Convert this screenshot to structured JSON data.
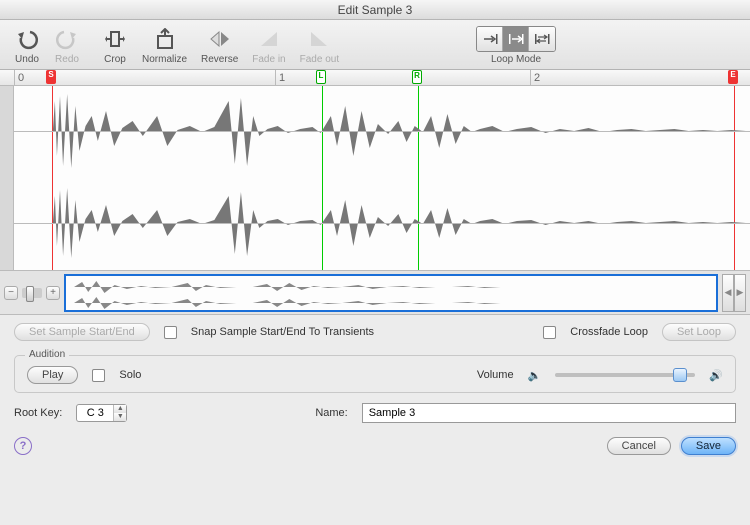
{
  "title": "Edit Sample 3",
  "toolbar": {
    "undo": "Undo",
    "redo": "Redo",
    "crop": "Crop",
    "normalize": "Normalize",
    "reverse": "Reverse",
    "fadein": "Fade in",
    "fadeout": "Fade out",
    "loopmode": "Loop Mode"
  },
  "ruler": {
    "t0": "0",
    "t1": "1",
    "t2": "2"
  },
  "markers": {
    "s": "S",
    "l": "L",
    "r": "R",
    "e": "E"
  },
  "controls": {
    "set_start_end": "Set Sample Start/End",
    "snap_transients": "Snap Sample Start/End To Transients",
    "crossfade_loop": "Crossfade Loop",
    "set_loop": "Set Loop"
  },
  "audition": {
    "legend": "Audition",
    "play": "Play",
    "solo": "Solo",
    "volume": "Volume"
  },
  "rootkey": {
    "label": "Root Key:",
    "value": "C 3"
  },
  "name": {
    "label": "Name:",
    "value": "Sample 3"
  },
  "footer": {
    "cancel": "Cancel",
    "save": "Save"
  },
  "help": "?"
}
